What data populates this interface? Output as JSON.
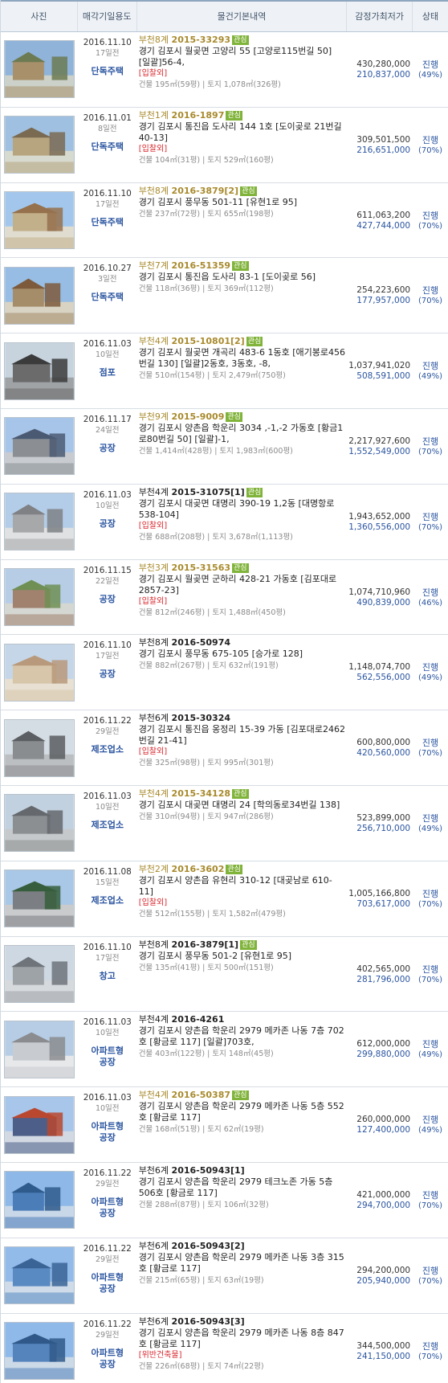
{
  "header": {
    "photo": "사진",
    "date_line1": "매각기일",
    "date_line2": "용도",
    "desc": "물건기본내역",
    "price_line1": "감정가",
    "price_line2": "최저가",
    "status": "상태"
  },
  "items": [
    {
      "date": "2016.11.10",
      "ago": "17일전",
      "use1": "단독주택",
      "use2": "",
      "court": "부천8계",
      "case": "2015-33293",
      "gold": true,
      "badge": "관심",
      "addr": "경기 김포시 월곶면 고양리 55 [고양로115번길 50] [일괄]56-4,",
      "note": "[입찰외]",
      "area": "건물 195㎡(59평) | 토지 1,078㎡(326평)",
      "appraisal": "430,280,000",
      "minimum": "210,837,000",
      "status": "진행",
      "pct": "(49%)"
    },
    {
      "date": "2016.11.01",
      "ago": "8일전",
      "use1": "단독주택",
      "use2": "",
      "court": "부천1계",
      "case": "2016-1897",
      "gold": true,
      "badge": "관심",
      "addr": "경기 김포시 통진읍 도사리 144 1호 [도이곶로 21번길 40-13]",
      "note": "[입찰외]",
      "area": "건물 104㎡(31평) | 토지 529㎡(160평)",
      "appraisal": "309,501,500",
      "minimum": "216,651,000",
      "status": "진행",
      "pct": "(70%)"
    },
    {
      "date": "2016.11.10",
      "ago": "17일전",
      "use1": "단독주택",
      "use2": "",
      "court": "부천8계",
      "case": "2016-3879[2]",
      "gold": true,
      "badge": "관심",
      "addr": "경기 김포시 풍무동 501-11 [유현1로 95]",
      "note": "",
      "area": "건물 237㎡(72평) | 토지 655㎡(198평)",
      "appraisal": "611,063,200",
      "minimum": "427,744,000",
      "status": "진행",
      "pct": "(70%)"
    },
    {
      "date": "2016.10.27",
      "ago": "3일전",
      "use1": "단독주택",
      "use2": "",
      "court": "부천7계",
      "case": "2016-51359",
      "gold": true,
      "badge": "관심",
      "addr": "경기 김포시 통진읍 도사리 83-1 [도이곶로 56]",
      "note": "",
      "area": "건물 118㎡(36평) | 토지 369㎡(112평)",
      "appraisal": "254,223,600",
      "minimum": "177,957,000",
      "status": "진행",
      "pct": "(70%)"
    },
    {
      "date": "2016.11.03",
      "ago": "10일전",
      "use1": "점포",
      "use2": "",
      "court": "부천4계",
      "case": "2015-10801[2]",
      "gold": true,
      "badge": "관심",
      "addr": "경기 김포시 월곶면 개곡리 483-6 1동호 [애기봉로456번길 130] [일괄]2동호, 3동호, -8,",
      "note": "",
      "area": "건물 510㎡(154평) | 토지 2,479㎡(750평)",
      "appraisal": "1,037,941,020",
      "minimum": "508,591,000",
      "status": "진행",
      "pct": "(49%)"
    },
    {
      "date": "2016.11.17",
      "ago": "24일전",
      "use1": "공장",
      "use2": "",
      "court": "부천9계",
      "case": "2015-9009",
      "gold": true,
      "badge": "관심",
      "addr": "경기 김포시 양촌읍 학운리 3034 ,-1,-2 가동호 [황금1로80번길 50] [일괄]-1,",
      "note": "",
      "area": "건물 1,414㎡(428평) | 토지 1,983㎡(600평)",
      "appraisal": "2,217,927,600",
      "minimum": "1,552,549,000",
      "status": "진행",
      "pct": "(70%)"
    },
    {
      "date": "2016.11.03",
      "ago": "10일전",
      "use1": "공장",
      "use2": "",
      "court": "부천4계",
      "case": "2015-31075[1]",
      "gold": false,
      "badge": "관심",
      "addr": "경기 김포시 대곶면 대명리 390-19 1,2동 [대명항로 538-104]",
      "note": "[입찰외]",
      "area": "건물 688㎡(208평) | 토지 3,678㎡(1,113평)",
      "appraisal": "1,943,652,000",
      "minimum": "1,360,556,000",
      "status": "진행",
      "pct": "(70%)"
    },
    {
      "date": "2016.11.15",
      "ago": "22일전",
      "use1": "공장",
      "use2": "",
      "court": "부천3계",
      "case": "2015-31563",
      "gold": true,
      "badge": "관심",
      "addr": "경기 김포시 월곶면 군하리 428-21 가동호 [김포대로 2857-23]",
      "note": "[입찰외]",
      "area": "건물 812㎡(246평) | 토지 1,488㎡(450평)",
      "appraisal": "1,074,710,960",
      "minimum": "490,839,000",
      "status": "진행",
      "pct": "(46%)"
    },
    {
      "date": "2016.11.10",
      "ago": "17일전",
      "use1": "공장",
      "use2": "",
      "court": "부천8계",
      "case": "2016-50974",
      "gold": false,
      "badge": "",
      "addr": "경기 김포시 풍무동 675-105 [승가로 128]",
      "note": "",
      "area": "건물 882㎡(267평) | 토지 632㎡(191평)",
      "appraisal": "1,148,074,700",
      "minimum": "562,556,000",
      "status": "진행",
      "pct": "(49%)"
    },
    {
      "date": "2016.11.22",
      "ago": "29일전",
      "use1": "제조업소",
      "use2": "",
      "court": "부천6계",
      "case": "2015-30324",
      "gold": false,
      "badge": "",
      "addr": "경기 김포시 통진읍 옹정리 15-39 가동 [김포대로2462번길 21-41]",
      "note": "[입찰외]",
      "area": "건물 325㎡(98평) | 토지 995㎡(301평)",
      "appraisal": "600,800,000",
      "minimum": "420,560,000",
      "status": "진행",
      "pct": "(70%)"
    },
    {
      "date": "2016.11.03",
      "ago": "10일전",
      "use1": "제조업소",
      "use2": "",
      "court": "부천4계",
      "case": "2015-34128",
      "gold": true,
      "badge": "관심",
      "addr": "경기 김포시 대곶면 대명리 24 [학의동로34번길 138]",
      "note": "",
      "area": "건물 310㎡(94평) | 토지 947㎡(286평)",
      "appraisal": "523,899,000",
      "minimum": "256,710,000",
      "status": "진행",
      "pct": "(49%)"
    },
    {
      "date": "2016.11.08",
      "ago": "15일전",
      "use1": "제조업소",
      "use2": "",
      "court": "부천2계",
      "case": "2016-3602",
      "gold": true,
      "badge": "관심",
      "addr": "경기 김포시 양촌읍 유현리 310-12 [대곶남로 610-11]",
      "note": "[입찰외]",
      "area": "건물 512㎡(155평) | 토지 1,582㎡(479평)",
      "appraisal": "1,005,166,800",
      "minimum": "703,617,000",
      "status": "진행",
      "pct": "(70%)"
    },
    {
      "date": "2016.11.10",
      "ago": "17일전",
      "use1": "창고",
      "use2": "",
      "court": "부천8계",
      "case": "2016-3879[1]",
      "gold": false,
      "badge": "관심",
      "addr": "경기 김포시 풍무동 501-2 [유현1로 95]",
      "note": "",
      "area": "건물 135㎡(41평) | 토지 500㎡(151평)",
      "appraisal": "402,565,000",
      "minimum": "281,796,000",
      "status": "진행",
      "pct": "(70%)"
    },
    {
      "date": "2016.11.03",
      "ago": "10일전",
      "use1": "아파트형",
      "use2": "공장",
      "court": "부천4계",
      "case": "2016-4261",
      "gold": false,
      "badge": "",
      "addr": "경기 김포시 양촌읍 학운리 2979 메카존 나동 7층 702호 [황금로 117] [일괄]703호,",
      "note": "",
      "area": "건물 403㎡(122평) | 토지 148㎡(45평)",
      "appraisal": "612,000,000",
      "minimum": "299,880,000",
      "status": "진행",
      "pct": "(49%)"
    },
    {
      "date": "2016.11.03",
      "ago": "10일전",
      "use1": "아파트형",
      "use2": "공장",
      "court": "부천4계",
      "case": "2016-50387",
      "gold": true,
      "badge": "관심",
      "addr": "경기 김포시 양촌읍 학운리 2979 메카존 나동 5층 552호 [황금로 117]",
      "note": "",
      "area": "건물 168㎡(51평) | 토지 62㎡(19평)",
      "appraisal": "260,000,000",
      "minimum": "127,400,000",
      "status": "진행",
      "pct": "(49%)"
    },
    {
      "date": "2016.11.22",
      "ago": "29일전",
      "use1": "아파트형",
      "use2": "공장",
      "court": "부천6계",
      "case": "2016-50943[1]",
      "gold": false,
      "badge": "",
      "addr": "경기 김포시 양촌읍 학운리 2979 테크노존 가동 5층 506호 [황금로 117]",
      "note": "",
      "area": "건물 288㎡(87평) | 토지 106㎡(32평)",
      "appraisal": "421,000,000",
      "minimum": "294,700,000",
      "status": "진행",
      "pct": "(70%)"
    },
    {
      "date": "2016.11.22",
      "ago": "29일전",
      "use1": "아파트형",
      "use2": "공장",
      "court": "부천6계",
      "case": "2016-50943[2]",
      "gold": false,
      "badge": "",
      "addr": "경기 김포시 양촌읍 학운리 2979 메카존 나동 3층 315호 [황금로 117]",
      "note": "",
      "area": "건물 215㎡(65평) | 토지 63㎡(19평)",
      "appraisal": "294,200,000",
      "minimum": "205,940,000",
      "status": "진행",
      "pct": "(70%)"
    },
    {
      "date": "2016.11.22",
      "ago": "29일전",
      "use1": "아파트형",
      "use2": "공장",
      "court": "부천6계",
      "case": "2016-50943[3]",
      "gold": false,
      "badge": "",
      "addr": "경기 김포시 양촌읍 학운리 2979 메카존 나동 8층 847호 [황금로 117]",
      "note": "[위반건축물]",
      "area": "건물 226㎡(68평) | 토지 74㎡(22평)",
      "appraisal": "344,500,000",
      "minimum": "241,150,000",
      "status": "진행",
      "pct": "(70%)"
    }
  ]
}
